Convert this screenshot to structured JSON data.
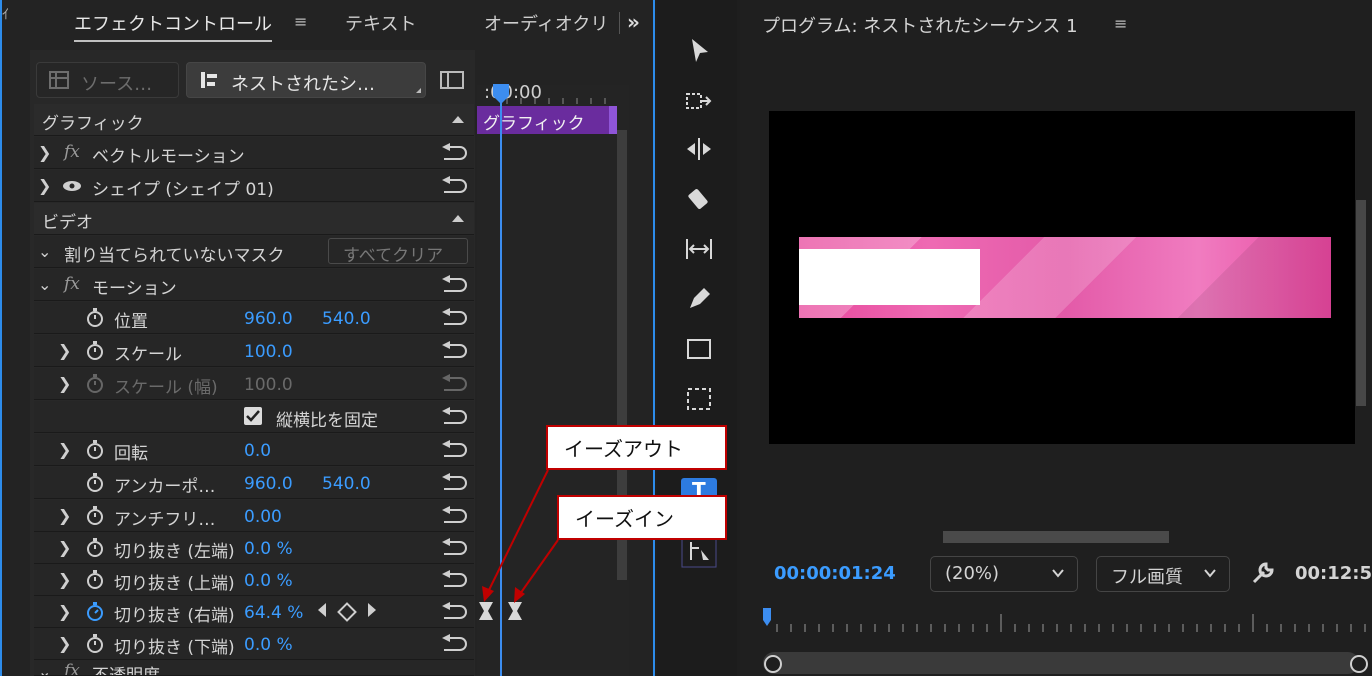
{
  "effect_panel": {
    "tabs": [
      "エフェクトコントロール",
      "テキスト",
      "オーディオクリ"
    ],
    "source_label": "ソース…",
    "sequence_label": "ネストされたシ…",
    "timeline_time": ":00:00",
    "timeline_clip_label": "グラフィック",
    "sections": {
      "graphic": "グラフィック",
      "video": "ビデオ"
    },
    "rows": {
      "vector_motion": "ベクトルモーション",
      "shape": "シェイプ (シェイプ 01)",
      "mask": "割り当てられていないマスク",
      "clear_all": "すべてクリア",
      "motion": "モーション",
      "position": {
        "label": "位置",
        "x": "960.0",
        "y": "540.0"
      },
      "scale": {
        "label": "スケール",
        "value": "100.0"
      },
      "scale_width": {
        "label": "スケール (幅)",
        "value": "100.0"
      },
      "uniform_scale": "縦横比を固定",
      "rotation": {
        "label": "回転",
        "value": "0.0"
      },
      "anchor": {
        "label": "アンカーポ…",
        "x": "960.0",
        "y": "540.0"
      },
      "anti_flicker": {
        "label": "アンチフリ…",
        "value": "0.00"
      },
      "crop_left": {
        "label": "切り抜き (左端)",
        "value": "0.0 %"
      },
      "crop_top": {
        "label": "切り抜き (上端)",
        "value": "0.0 %"
      },
      "crop_right": {
        "label": "切り抜き (右端)",
        "value": "64.4 %"
      },
      "crop_bottom": {
        "label": "切り抜き (下端)",
        "value": "0.0 %"
      },
      "opacity": "不透明度"
    }
  },
  "callouts": {
    "ease_out": "イーズアウト",
    "ease_in": "イーズイン"
  },
  "program": {
    "title": "プログラム: ネストされたシーケンス 1",
    "timecode": "00:00:01:24",
    "zoom": "(20%)",
    "quality": "フル画質",
    "duration": "00:12:5"
  },
  "colors": {
    "accent": "#3b9cff",
    "clip": "#6a2c9e",
    "graphic_pink": "#e9559f",
    "callout_border": "#c00000"
  }
}
